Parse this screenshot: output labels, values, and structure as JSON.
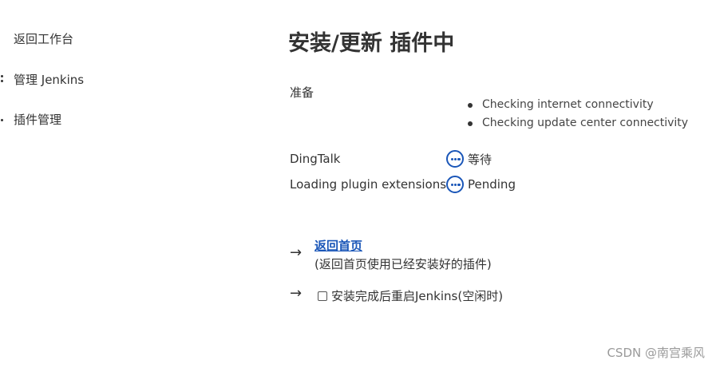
{
  "sidebar": {
    "items": [
      {
        "label": "返回工作台",
        "icon": "back-icon"
      },
      {
        "label": "管理 Jenkins",
        "icon": "gear-icon"
      },
      {
        "label": "插件管理",
        "icon": "plug-icon"
      }
    ]
  },
  "main": {
    "title": "安装/更新 插件中",
    "prep": {
      "label": "准备",
      "items": [
        "Checking internet connectivity",
        "Checking update center connectivity"
      ]
    },
    "plugins": [
      {
        "name": "DingTalk",
        "status": "等待",
        "icon": "pending-icon"
      },
      {
        "name": "Loading plugin extensions",
        "status": "Pending",
        "icon": "pending-icon"
      }
    ],
    "home_link": {
      "label": "返回首页",
      "description": "(返回首页使用已经安装好的插件)"
    },
    "restart": {
      "label": "安装完成后重启Jenkins(空闲时)",
      "checked": false
    },
    "arrow_glyph": "→"
  },
  "colors": {
    "accent": "#1a56b8",
    "text": "#333333",
    "watermark": "#9a9a9a"
  },
  "watermark": "CSDN @南宫乘风"
}
